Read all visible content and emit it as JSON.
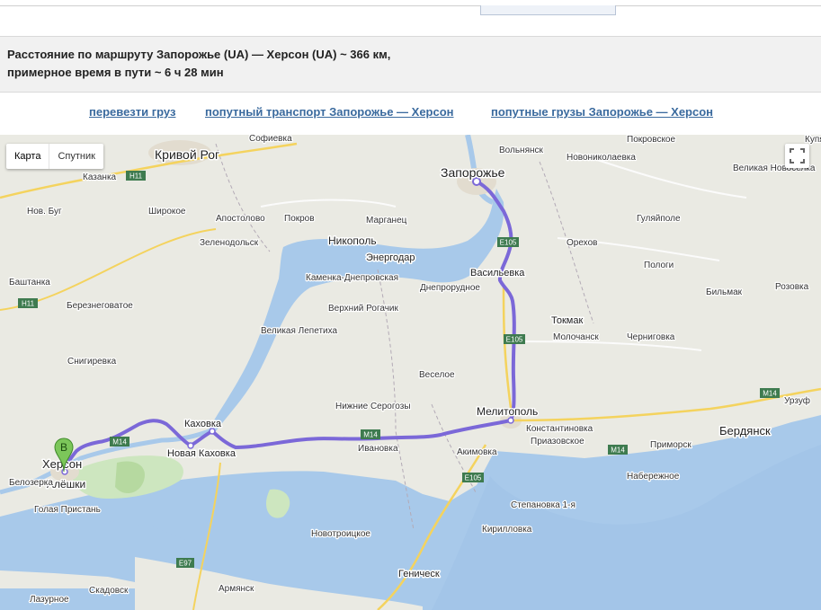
{
  "route": {
    "line1": "Расстояние по маршруту Запорожье (UA) — Херсон (UA) ~ 366 км,",
    "line2": "примерное время в пути ~ 6 ч 28 мин"
  },
  "links": {
    "cargo": "перевезти груз",
    "transport": "попутный транспорт Запорожье — Херсон",
    "loads": "попутные грузы Запорожье — Херсон"
  },
  "map": {
    "type_map": "Карта",
    "type_satellite": "Спутник",
    "marker_label": "B",
    "cities": [
      "Кривой Рог",
      "Запорожье",
      "Никополь",
      "Энергодар",
      "Васильевка",
      "Токмак",
      "Мелитополь",
      "Каховка",
      "Новая Каховка",
      "Херсон",
      "Алёшки",
      "Бердянск",
      "Геническ"
    ],
    "towns": [
      "Софиевка",
      "Вольнянск",
      "Покровское",
      "Новониколаевка",
      "Купянка",
      "Казанка",
      "Широкое",
      "Апостолово",
      "Покров",
      "Марганец",
      "Гуляйполе",
      "Великая Новоселка",
      "Нов. Буг",
      "Зеленодольск",
      "Орехов",
      "Пологи",
      "Каменка-Днепровская",
      "Днепрорудное",
      "Баштанка",
      "Березнеговатое",
      "Великая Лепетиха",
      "Верхний Рогачик",
      "Бильмак",
      "Розовка",
      "Молочанск",
      "Черниговка",
      "Снигиревка",
      "Веселое",
      "Нижние Серогозы",
      "Константиновка",
      "Приазовское",
      "Урзуф",
      "Приморск",
      "Набережное",
      "Ивановка",
      "Акимовка",
      "Белозерка",
      "Голая Пристань",
      "Степановка 1-я",
      "Новотроицкое",
      "Кирилловка",
      "Скадовск",
      "Армянск",
      "Лазурное"
    ],
    "roads": [
      "H11",
      "H11",
      "E105",
      "E105",
      "M14",
      "M14",
      "M14",
      "M14",
      "E105",
      "E97"
    ]
  }
}
